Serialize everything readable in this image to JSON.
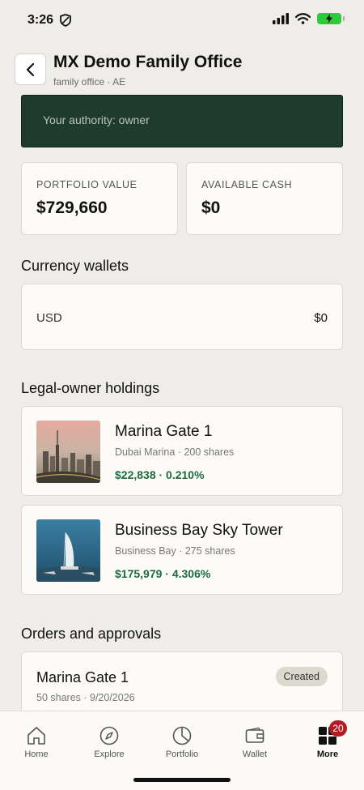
{
  "status_bar": {
    "time": "3:26"
  },
  "header": {
    "back_icon": "chevron-left-icon",
    "title": "MX Demo Family Office",
    "subtitle": "family office · AE"
  },
  "authority": {
    "text": "Your authority: owner"
  },
  "stats": [
    {
      "label": "PORTFOLIO VALUE",
      "value": "$729,660"
    },
    {
      "label": "AVAILABLE CASH",
      "value": "$0"
    }
  ],
  "wallets": {
    "title": "Currency wallets",
    "items": [
      {
        "currency": "USD",
        "amount": "$0"
      }
    ]
  },
  "holdings": {
    "title": "Legal-owner holdings",
    "items": [
      {
        "name": "Marina Gate 1",
        "details": "Dubai Marina · 200 shares",
        "value": "$22,838 · 0.210%"
      },
      {
        "name": "Business Bay Sky Tower",
        "details": "Business Bay · 275 shares",
        "value": "$175,979 · 4.306%"
      }
    ]
  },
  "orders": {
    "title": "Orders and approvals",
    "items": [
      {
        "name": "Marina Gate 1",
        "details": "50 shares · 9/20/2026",
        "status": "Created"
      }
    ]
  },
  "nav": {
    "items": [
      {
        "label": "Home",
        "icon": "home-icon"
      },
      {
        "label": "Explore",
        "icon": "compass-icon"
      },
      {
        "label": "Portfolio",
        "icon": "pie-chart-icon"
      },
      {
        "label": "Wallet",
        "icon": "wallet-icon"
      },
      {
        "label": "More",
        "icon": "grid-icon",
        "badge": "20"
      }
    ]
  },
  "colors": {
    "background": "#efede9",
    "banner": "#1f3a2f",
    "positive": "#1c6b3f",
    "badge": "#b41c24"
  }
}
